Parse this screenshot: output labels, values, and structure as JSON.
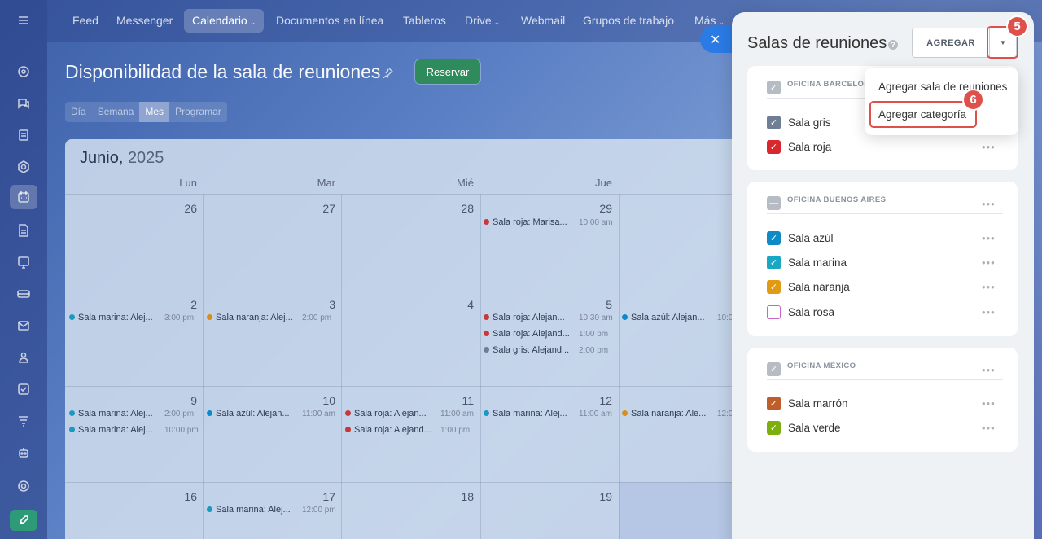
{
  "nav": {
    "items": [
      {
        "label": "Feed"
      },
      {
        "label": "Messenger"
      },
      {
        "label": "Calendario"
      },
      {
        "label": "Documentos en línea"
      },
      {
        "label": "Tableros"
      },
      {
        "label": "Drive"
      },
      {
        "label": "Webmail"
      },
      {
        "label": "Grupos de trabajo"
      },
      {
        "label": "Más"
      }
    ],
    "chevron": "⌄"
  },
  "page": {
    "title": "Disponibilidad de la sala de reuniones",
    "reserve_label": "Reservar",
    "view_tabs": [
      "Día",
      "Semana",
      "Mes",
      "Programar"
    ]
  },
  "calendar": {
    "month": "Junio,",
    "year": "2025",
    "weekdays": [
      "Lun",
      "Mar",
      "Mié",
      "Jue"
    ],
    "days": [
      "26",
      "27",
      "28",
      "29",
      "2",
      "3",
      "4",
      "5",
      "9",
      "10",
      "11",
      "12",
      "16",
      "17",
      "18",
      "19"
    ],
    "events": [
      {
        "name": "Sala roja: Marisa...",
        "time": "10:00 am",
        "color": "#c8373a"
      },
      {
        "name": "Sala marina: Alej...",
        "time": "3:00 pm",
        "color": "#1a9ac0"
      },
      {
        "name": "Sala naranja: Alej...",
        "time": "2:00 pm",
        "color": "#d88d1c"
      },
      {
        "name": "Sala roja: Alejan...",
        "time": "10:30 am",
        "color": "#c8373a"
      },
      {
        "name": "Sala roja: Alejand...",
        "time": "1:00 pm",
        "color": "#c8373a"
      },
      {
        "name": "Sala gris: Alejand...",
        "time": "2:00 pm",
        "color": "#6e7f95"
      },
      {
        "name": "Sala azúl: Alejan...",
        "time": "10:0",
        "color": "#0d8bc7"
      },
      {
        "name": "Sala marina: Alej...",
        "time": "2:00 pm",
        "color": "#1a9ac0"
      },
      {
        "name": "Sala marina: Alej...",
        "time": "10:00 pm",
        "color": "#1a9ac0"
      },
      {
        "name": "Sala azúl: Alejan...",
        "time": "11:00 am",
        "color": "#0d8bc7"
      },
      {
        "name": "Sala roja: Alejan...",
        "time": "11:00 am",
        "color": "#c8373a"
      },
      {
        "name": "Sala roja: Alejand...",
        "time": "1:00 pm",
        "color": "#c8373a"
      },
      {
        "name": "Sala marina: Alej...",
        "time": "11:00 am",
        "color": "#1a9ac0"
      },
      {
        "name": "Sala naranja: Ale...",
        "time": "12:0",
        "color": "#d88d1c"
      },
      {
        "name": "Sala marina: Alej...",
        "time": "12:00 pm",
        "color": "#1a9ac0"
      }
    ]
  },
  "panel": {
    "title": "Salas de reuniones",
    "help": "?",
    "add_label": "AGREGAR",
    "dropdown_arrow": "▼",
    "step5": "5",
    "step6": "6",
    "menu": {
      "add_room": "Agregar sala de reuniones",
      "add_category": "Agregar categoría"
    },
    "categories": [
      {
        "label": "OFICINA BARCELON",
        "rooms": [
          {
            "label": "Sala gris",
            "color": "#6e7f95"
          },
          {
            "label": "Sala roja",
            "color": "#d8282e"
          }
        ]
      },
      {
        "label": "OFICINA BUENOS AIRES",
        "rooms": [
          {
            "label": "Sala azúl",
            "color": "#0d8bc7"
          },
          {
            "label": "Sala marina",
            "color": "#1aa7c4"
          },
          {
            "label": "Sala naranja",
            "color": "#e09a14"
          },
          {
            "label": "Sala rosa",
            "color": "#c466c6"
          }
        ]
      },
      {
        "label": "OFICINA MÉXICO",
        "rooms": [
          {
            "label": "Sala marrón",
            "color": "#c05e2a"
          },
          {
            "label": "Sala verde",
            "color": "#7cae0c"
          }
        ]
      }
    ],
    "more": "•••"
  },
  "colors": {
    "accent": "#2b7be6",
    "highlight": "#e0504a",
    "reserve": "#2f8b5c"
  }
}
